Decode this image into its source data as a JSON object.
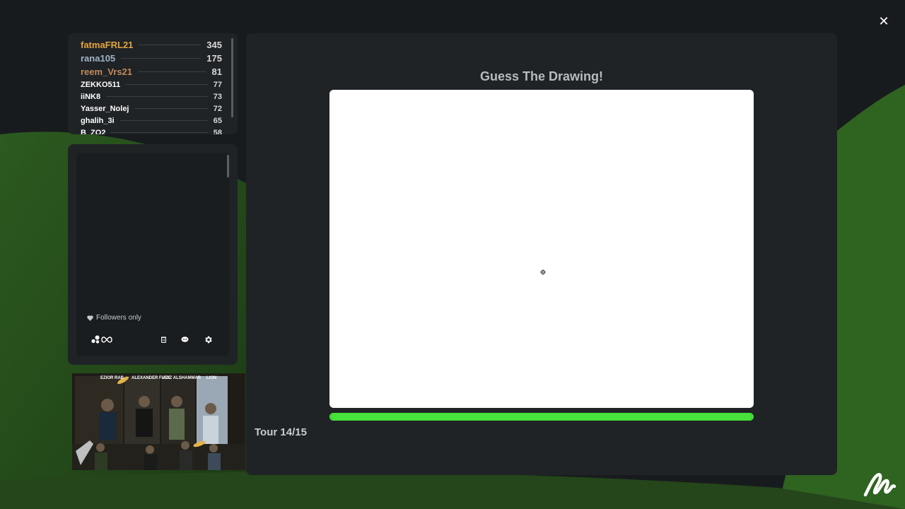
{
  "window": {
    "close_label": "✕"
  },
  "leaderboard": {
    "players": [
      {
        "name": "fatmaFRL21",
        "score": "345",
        "color": "#e3a53e",
        "size": "big"
      },
      {
        "name": "rana105",
        "score": "175",
        "color": "#9fb3c8",
        "size": "big"
      },
      {
        "name": "reem_Vrs21",
        "score": "81",
        "color": "#c08a5a",
        "size": "big"
      },
      {
        "name": "ZEKKO511",
        "score": "77",
        "color": "#ffffff",
        "size": "small"
      },
      {
        "name": "iiNK8",
        "score": "73",
        "color": "#ffffff",
        "size": "small"
      },
      {
        "name": "Yasser_Nolej",
        "score": "72",
        "color": "#ffffff",
        "size": "small"
      },
      {
        "name": "ghalih_3i",
        "score": "65",
        "color": "#ffffff",
        "size": "small"
      },
      {
        "name": "B_ZO2",
        "score": "58",
        "color": "#ffffff",
        "size": "small"
      }
    ]
  },
  "chat": {
    "followers_only_label": "Followers only",
    "tools": {
      "players_icon": "players-icon",
      "infinity_icon": "infinity-icon",
      "trash_icon": "trash-icon",
      "chat_icon": "chat-bubble-icon",
      "settings_icon": "gear-icon"
    }
  },
  "ad": {
    "banner_labels": [
      "EZIOR RAB",
      "ALEXANDER FLEX",
      "AZIZ ALSHAMMAR",
      "LION"
    ]
  },
  "game": {
    "title": "Guess The Drawing!",
    "round_label": "Tour 14/15",
    "progress": 1.0
  },
  "colors": {
    "accent_green": "#47e23a",
    "panel": "#1f2326",
    "background": "#181b1e"
  }
}
